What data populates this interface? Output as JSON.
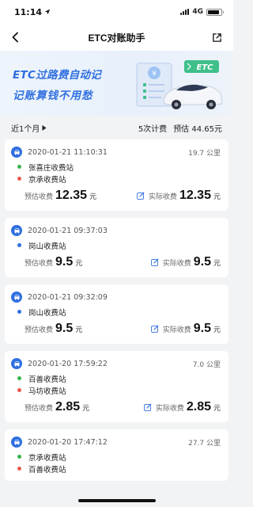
{
  "status": {
    "time": "11:14",
    "network": "4G"
  },
  "nav": {
    "title": "ETC对账助手"
  },
  "banner": {
    "line1": "ETC过路费自动记",
    "line2": "记账算钱不用愁",
    "badge": "ETC"
  },
  "summary": {
    "filter": "近1个月",
    "count": "5次计费",
    "estimate": "预估 44.65元"
  },
  "labels": {
    "est_fee": "预估收费",
    "actual_fee": "实际收费",
    "unit": "元"
  },
  "records": [
    {
      "time": "2020-01-21 11:10:31",
      "distance": "19.7 公里",
      "stations": [
        {
          "name": "张喜庄收费站",
          "dot": "green"
        },
        {
          "name": "京承收费站",
          "dot": "red"
        }
      ],
      "est": "12.35",
      "actual": "12.35"
    },
    {
      "time": "2020-01-21 09:37:03",
      "distance": "",
      "stations": [
        {
          "name": "岗山收费站",
          "dot": "blue"
        }
      ],
      "est": "9.5",
      "actual": "9.5"
    },
    {
      "time": "2020-01-21 09:32:09",
      "distance": "",
      "stations": [
        {
          "name": "岗山收费站",
          "dot": "blue"
        }
      ],
      "est": "9.5",
      "actual": "9.5"
    },
    {
      "time": "2020-01-20 17:59:22",
      "distance": "7.0 公里",
      "stations": [
        {
          "name": "百善收费站",
          "dot": "green"
        },
        {
          "name": "马坊收费站",
          "dot": "red"
        }
      ],
      "est": "2.85",
      "actual": "2.85"
    },
    {
      "time": "2020-01-20 17:47:12",
      "distance": "27.7 公里",
      "stations": [
        {
          "name": "京承收费站",
          "dot": "green"
        },
        {
          "name": "百善收费站",
          "dot": "red"
        }
      ],
      "est": "",
      "actual": ""
    }
  ],
  "colors": {
    "accent": "#2f6fe0",
    "green": "#37b24d",
    "red": "#e8574d",
    "background": "#f2f3f5"
  }
}
